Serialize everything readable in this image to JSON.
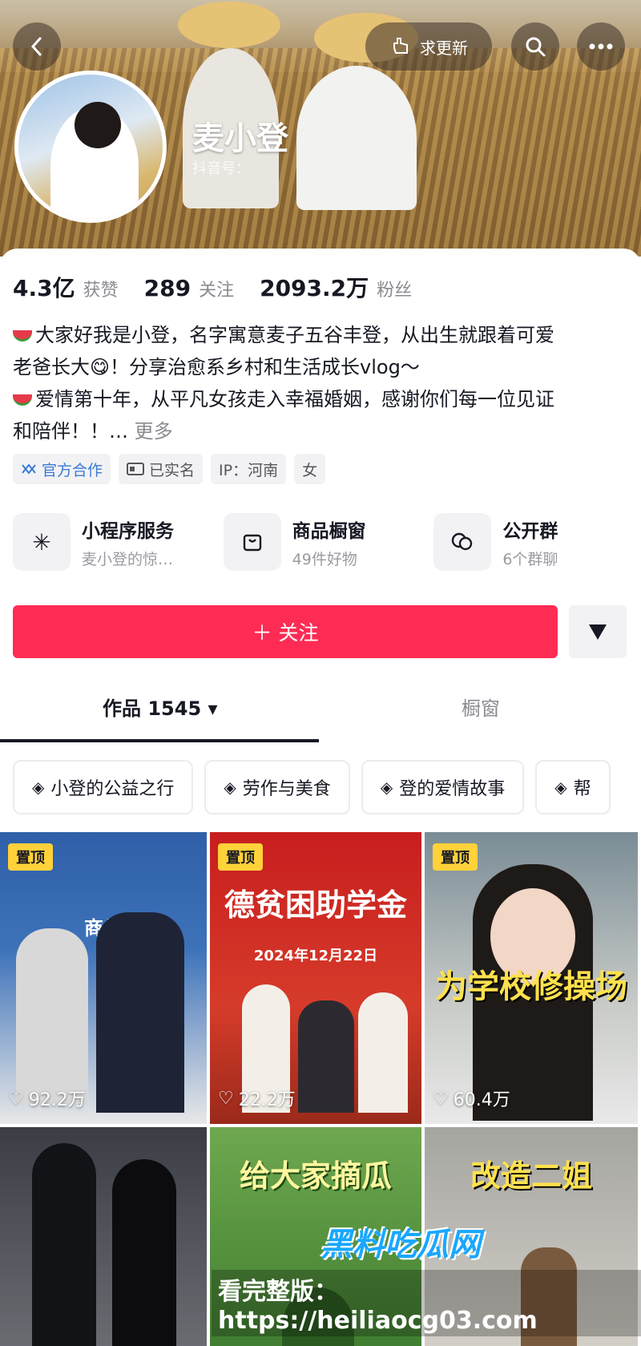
{
  "header": {
    "refresh_label": "求更新",
    "name": "麦小登",
    "douyin_id_label": "抖音号："
  },
  "stats": [
    {
      "value": "4.3亿",
      "label": "获赞"
    },
    {
      "value": "289",
      "label": "关注"
    },
    {
      "value": "2093.2万",
      "label": "粉丝"
    }
  ],
  "bio": {
    "line1": "大家好我是小登，名字寓意麦子五谷丰登，从出生就跟着可爱",
    "line2": "老爸长大😋！分享治愈系乡村和生活成长vlog～",
    "line3": "爱情第十年，从平凡女孩走入幸福婚姻，感谢你们每一位见证",
    "line4": "和陪伴！！…",
    "more": "更多"
  },
  "tags": {
    "official": "官方合作",
    "verified": "已实名",
    "ip": "IP：河南",
    "gender": "女"
  },
  "services": [
    {
      "title": "小程序服务",
      "sub": "麦小登的惊…"
    },
    {
      "title": "商品橱窗",
      "sub": "49件好物"
    },
    {
      "title": "公开群",
      "sub": "6个群聊"
    }
  ],
  "actions": {
    "follow": "＋ 关注"
  },
  "tabs": {
    "works": "作品 1545 ▾",
    "window": "橱窗"
  },
  "collections": [
    "小登的公益之行",
    "劳作与美食",
    "登的爱情故事",
    "帮"
  ],
  "videos": [
    {
      "pin": "置顶",
      "likes": "92.2万",
      "title": "商品"
    },
    {
      "pin": "置顶",
      "likes": "22.2万",
      "title": "德贫困助学金",
      "date": "2024年12月22日"
    },
    {
      "pin": "置顶",
      "likes": "60.4万",
      "title": "为学校修操场"
    },
    {
      "title": ""
    },
    {
      "title": "给大家摘瓜"
    },
    {
      "title": "改造二姐"
    }
  ],
  "watermark": {
    "brand": "黑料吃瓜网",
    "url": "看完整版：https://heiliaocg03.com"
  }
}
